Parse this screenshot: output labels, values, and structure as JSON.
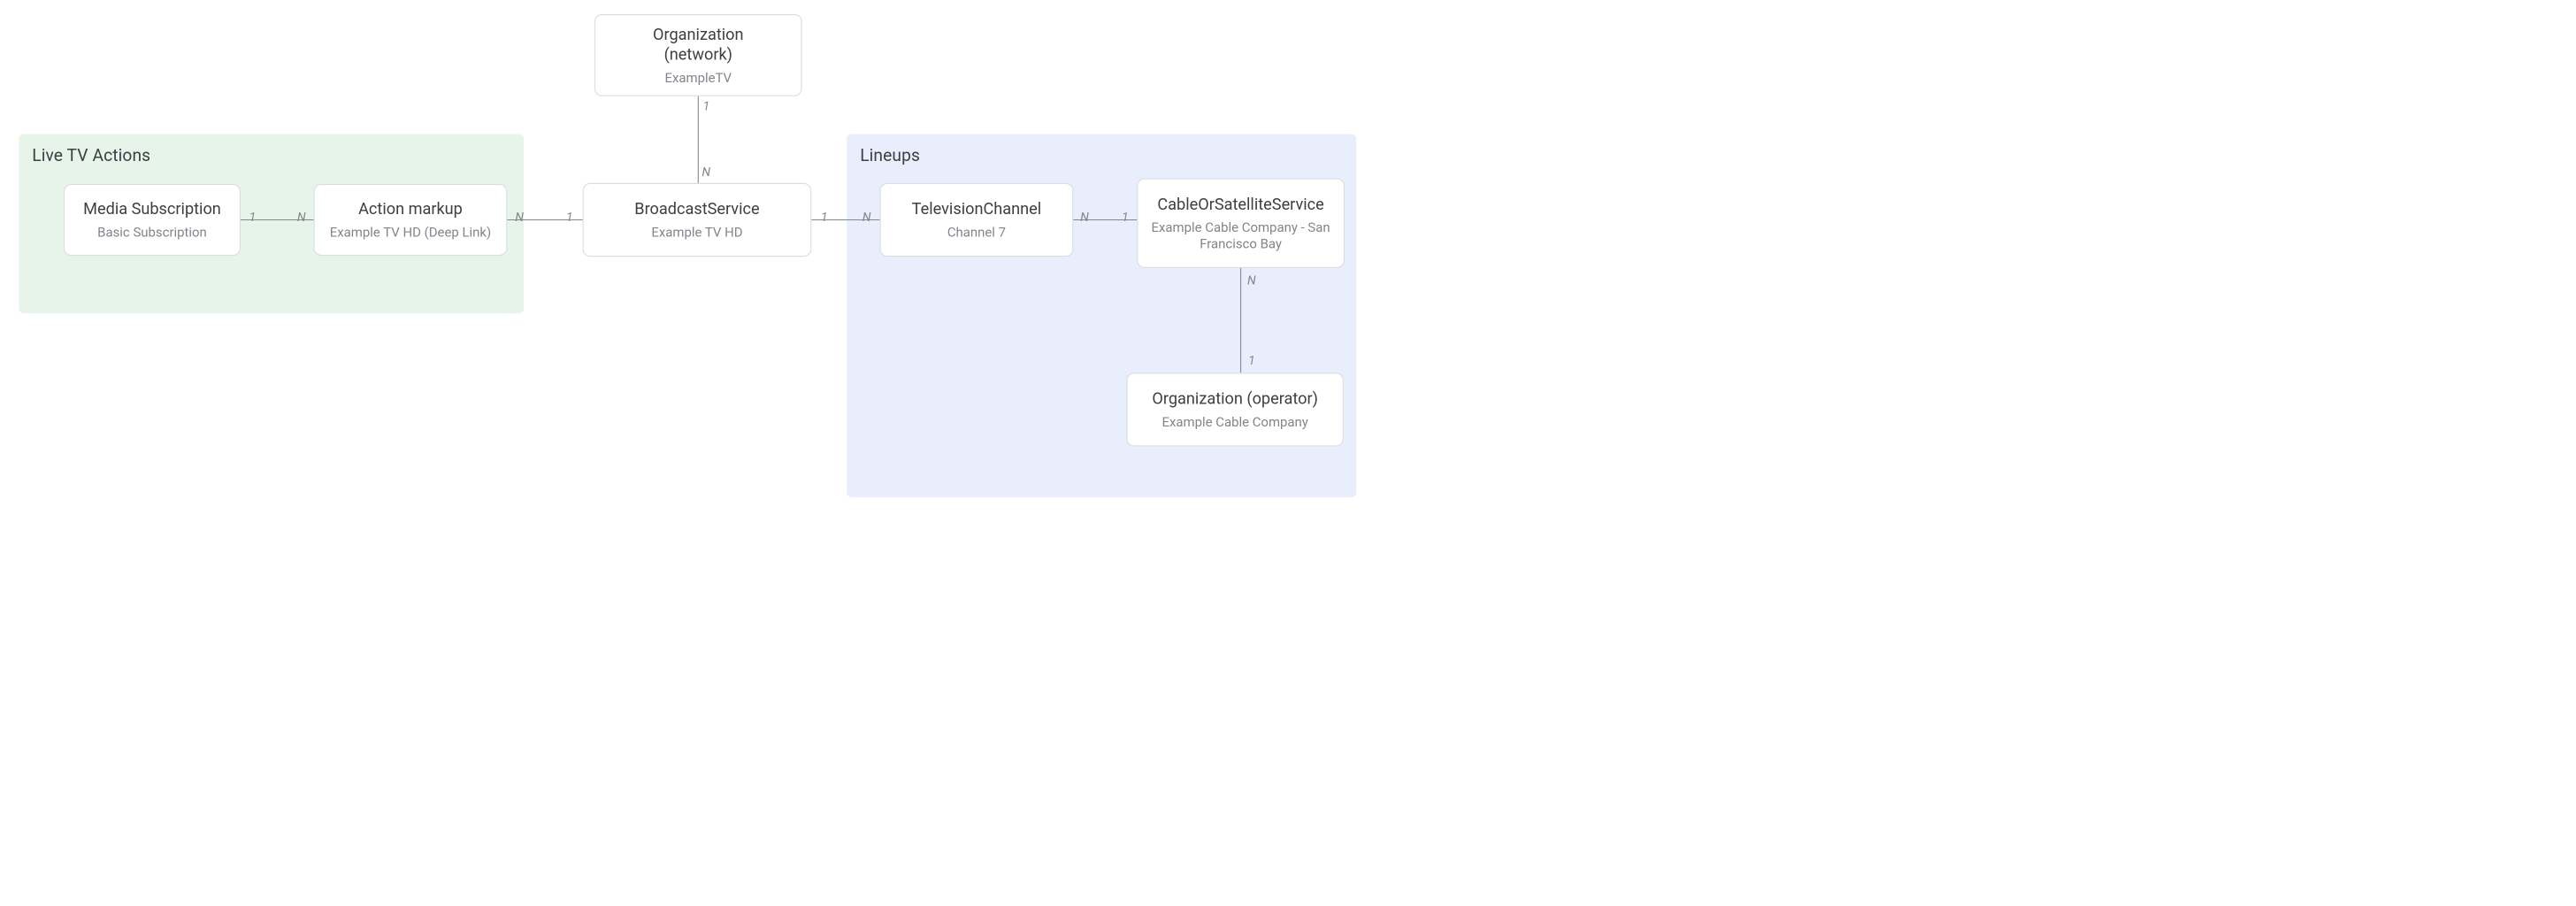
{
  "groups": {
    "live": {
      "title": "Live TV Actions"
    },
    "lineups": {
      "title": "Lineups"
    }
  },
  "nodes": {
    "org_network": {
      "title": "Organization\n(network)",
      "sub": "ExampleTV"
    },
    "media_sub": {
      "title": "Media Subscription",
      "sub": "Basic Subscription"
    },
    "action": {
      "title": "Action markup",
      "sub": "Example TV HD (Deep Link)"
    },
    "broadcast": {
      "title": "BroadcastService",
      "sub": "Example TV HD"
    },
    "tvchannel": {
      "title": "TelevisionChannel",
      "sub": "Channel 7"
    },
    "cable": {
      "title": "CableOrSatelliteService",
      "sub": "Example Cable Company - San Francisco Bay"
    },
    "org_op": {
      "title": "Organization (operator)",
      "sub": "Example Cable Company"
    }
  },
  "edges": {
    "org_broadcast": {
      "a": "1",
      "b": "N"
    },
    "media_action": {
      "a": "1",
      "b": "N"
    },
    "action_broadcast": {
      "a": "N",
      "b": "1"
    },
    "broadcast_tv": {
      "a": "1",
      "b": "N"
    },
    "tv_cable": {
      "a": "N",
      "b": "1"
    },
    "cable_orgop": {
      "a": "N",
      "b": "1"
    }
  }
}
